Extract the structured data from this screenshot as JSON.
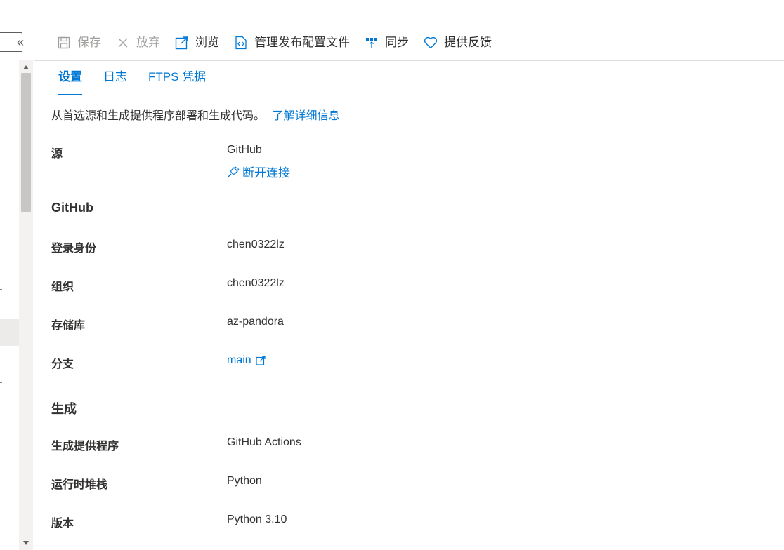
{
  "toolbar": {
    "save": {
      "label": "保存",
      "icon": "save-icon",
      "disabled": true
    },
    "discard": {
      "label": "放弃",
      "icon": "close-icon",
      "disabled": true
    },
    "browse": {
      "label": "浏览",
      "icon": "external-link-icon"
    },
    "manage_publish_profile": {
      "label": "管理发布配置文件",
      "icon": "publish-profile-icon"
    },
    "sync": {
      "label": "同步",
      "icon": "sync-icon"
    },
    "feedback": {
      "label": "提供反馈",
      "icon": "heart-icon"
    }
  },
  "tabs": [
    {
      "label": "设置",
      "active": true
    },
    {
      "label": "日志",
      "active": false
    },
    {
      "label": "FTPS 凭据",
      "active": false
    }
  ],
  "intro": {
    "text": "从首选源和生成提供程序部署和生成代码。",
    "link": "了解详细信息"
  },
  "source": {
    "label": "源",
    "value": "GitHub",
    "disconnect": "断开连接"
  },
  "github_section": {
    "heading": "GitHub",
    "fields": [
      {
        "label": "登录身份",
        "value": "chen0322lz"
      },
      {
        "label": "组织",
        "value": "chen0322lz"
      },
      {
        "label": "存储库",
        "value": "az-pandora"
      },
      {
        "label": "分支",
        "value": "main"
      }
    ]
  },
  "build_section": {
    "heading": "生成",
    "fields": [
      {
        "label": "生成提供程序",
        "value": "GitHub Actions"
      },
      {
        "label": "运行时堆栈",
        "value": "Python"
      },
      {
        "label": "版本",
        "value": "Python 3.10"
      }
    ]
  },
  "colors": {
    "accent": "#0078d4",
    "text": "#323130",
    "disabled": "#a19f9d",
    "divider": "#e1dfdd"
  }
}
